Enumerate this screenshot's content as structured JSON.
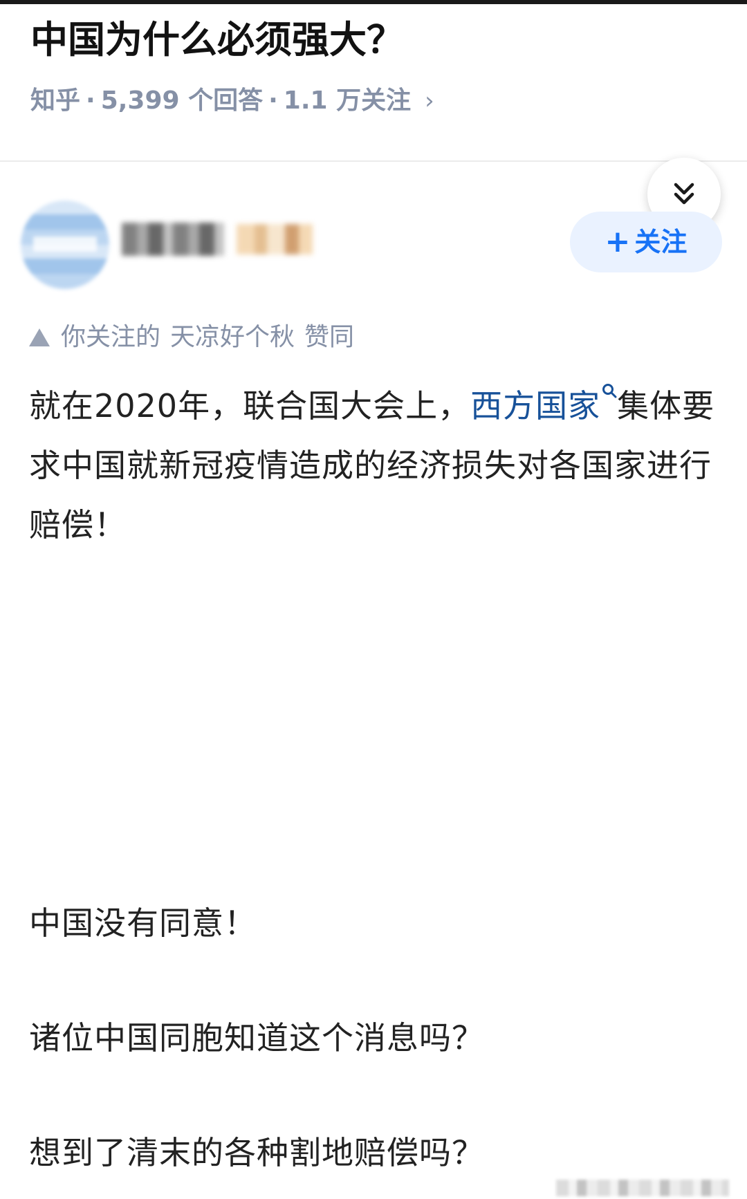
{
  "question": {
    "title": "中国为什么必须强大？",
    "meta": {
      "source": "知乎",
      "answers": "5,399 个回答",
      "follows": "1.1 万关注",
      "separator": "·",
      "chevron": "›"
    }
  },
  "author": {
    "follow_button": {
      "plus": "+",
      "label": "关注"
    }
  },
  "social_proof": {
    "prefix": "你关注的",
    "user": "天凉好个秋",
    "action": "赞同"
  },
  "answer": {
    "p1_before": "就在2020年，联合国大会上，",
    "p1_link": "西方国家",
    "p1_after": "集体要求中国就新冠疫情造成的经济损失对各国家进行赔偿！",
    "p2": "中国没有同意！",
    "p3": "诸位中国同胞知道这个消息吗？",
    "p4": "想到了清末的各种割地赔偿吗？"
  },
  "colors": {
    "brand_blue": "#1772f6",
    "link_blue": "#175199",
    "meta_gray": "#8590a6"
  },
  "icons": {
    "expand": "double-chevron-down-icon",
    "search": "search-icon",
    "upvote": "triangle-up-icon"
  }
}
